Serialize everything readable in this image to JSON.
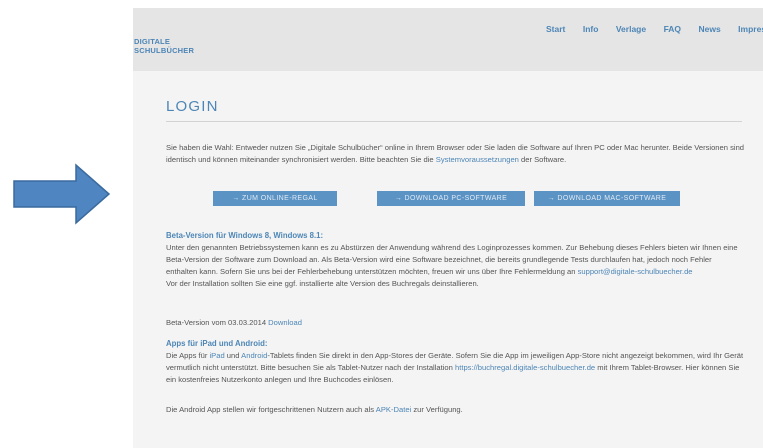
{
  "colors": {
    "accent": "#4d86b6",
    "button": "#5b93c4",
    "arrow_fill": "#4f85c0",
    "arrow_stroke": "#3a6a9e",
    "header_bg": "#e5e5e5",
    "content_bg": "#f4f4f4"
  },
  "annotation_icon": "arrow-right-icon",
  "logo": {
    "line1": "DIGITALE",
    "line2": "SCHULBÜCHER"
  },
  "nav": {
    "items": [
      {
        "label": "Start"
      },
      {
        "label": "Info"
      },
      {
        "label": "Verlage"
      },
      {
        "label": "FAQ"
      },
      {
        "label": "News"
      },
      {
        "label": "Impressum"
      }
    ]
  },
  "page": {
    "title": "LOGIN",
    "intro": {
      "before_link": "Sie haben die Wahl: Entweder nutzen Sie „Digitale Schulbücher“ online in Ihrem Browser oder Sie laden die Software auf Ihren PC oder Mac herunter. Beide Versionen sind identisch und können miteinander synchronisiert werden. Bitte beachten Sie die ",
      "link": "Systemvoraussetzungen",
      "after_link": " der Software."
    },
    "buttons": {
      "online": "→  ZUM ONLINE-REGAL",
      "pc": "→  DOWNLOAD PC-SOFTWARE",
      "mac": "→  DOWNLOAD MAC-SOFTWARE"
    },
    "beta": {
      "heading": "Beta-Version für Windows 8, Windows 8.1:",
      "text": "Unter den genannten Betriebssystemen kann es zu Abstürzen der Anwendung während des Loginprozesses kommen. Zur Behebung dieses Fehlers bieten wir Ihnen eine Beta-Version der Software zum Download an. Als Beta-Version wird eine Software bezeichnet, die bereits grundlegende Tests durchlaufen hat, jedoch noch Fehler enthalten kann. Sofern Sie uns bei der Fehlerbehebung unterstützen möchten, freuen wir uns über Ihre Fehlermeldung an ",
      "email": "support@digitale-schulbuecher.de",
      "note": "Vor der Installation sollten Sie eine ggf. installierte alte Version des Buchregals deinstallieren.",
      "version_text": "Beta-Version vom 03.03.2014 ",
      "download_link": "Download"
    },
    "apps": {
      "heading": "Apps für iPad und Android:",
      "t1": "Die Apps für ",
      "ipad": "iPad",
      "t2": " und ",
      "android": "Android",
      "t3": "-Tablets finden Sie direkt in den App-Stores der Geräte. Sofern Sie die App im jeweiligen App-Store nicht angezeigt bekommen, wird Ihr Gerät vermutlich nicht unterstützt. Bitte besuchen Sie als Tablet-Nutzer nach der Installation ",
      "url": "https://buchregal.digitale-schulbuecher.de",
      "t4": " mit Ihrem Tablet-Browser. Hier können Sie ein kostenfreies Nutzerkonto anlegen und Ihre Buchcodes einlösen.",
      "apk_before": "Die Android App stellen wir fortgeschrittenen Nutzern auch als ",
      "apk_link": "APK-Datei",
      "apk_after": " zur Verfügung."
    }
  }
}
